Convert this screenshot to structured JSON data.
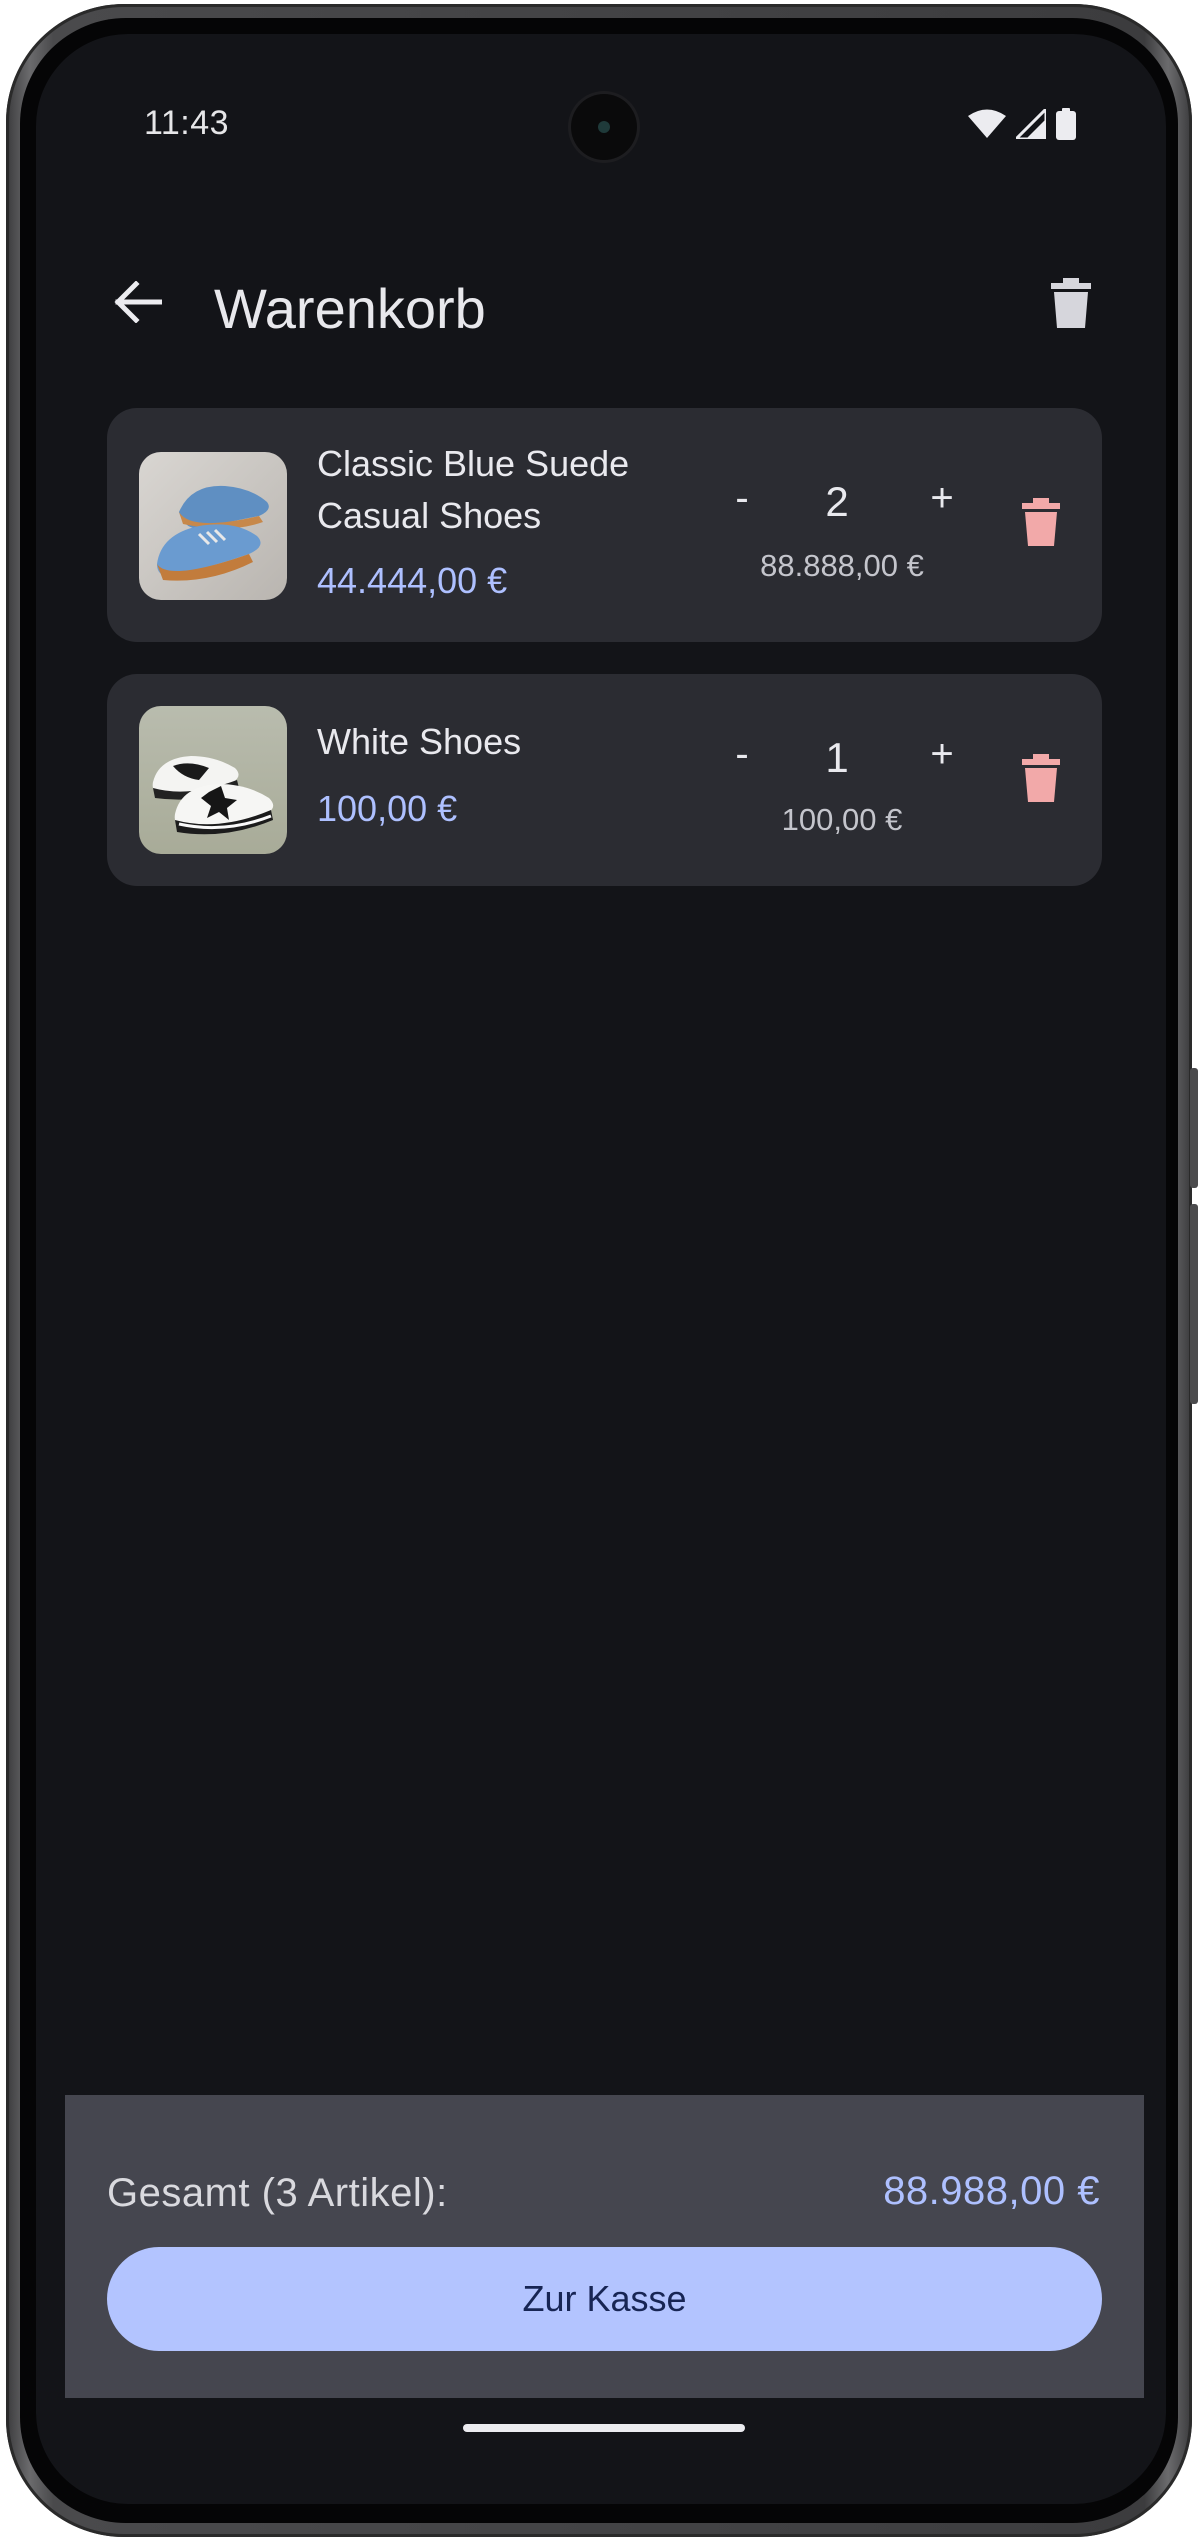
{
  "status_bar": {
    "time": "11:43"
  },
  "app_bar": {
    "title": "Warenkorb",
    "back_icon": "arrow-back-icon",
    "clear_icon": "trash-icon"
  },
  "cart": {
    "items": [
      {
        "name": "Classic Blue Suede Casual Shoes",
        "unit_price": "44.444,00 €",
        "quantity": "2",
        "line_total": "88.888,00 €",
        "minus_label": "-",
        "plus_label": "+",
        "image": "blue-suede-shoes-photo",
        "delete_icon": "trash-icon"
      },
      {
        "name": "White Shoes",
        "unit_price": "100,00 €",
        "quantity": "1",
        "line_total": "100,00 €",
        "minus_label": "-",
        "plus_label": "+",
        "image": "white-sneakers-photo",
        "delete_icon": "trash-icon"
      }
    ]
  },
  "summary": {
    "label": "Gesamt (3 Artikel):",
    "total": "88.988,00 €",
    "checkout_label": "Zur Kasse"
  },
  "colors": {
    "background": "#131418",
    "card": "#2b2c32",
    "accent_price": "#aec0ff",
    "delete_icon": "#f2a9a9",
    "checkout_button": "#b3c4ff",
    "summary_panel": "#45464f"
  }
}
